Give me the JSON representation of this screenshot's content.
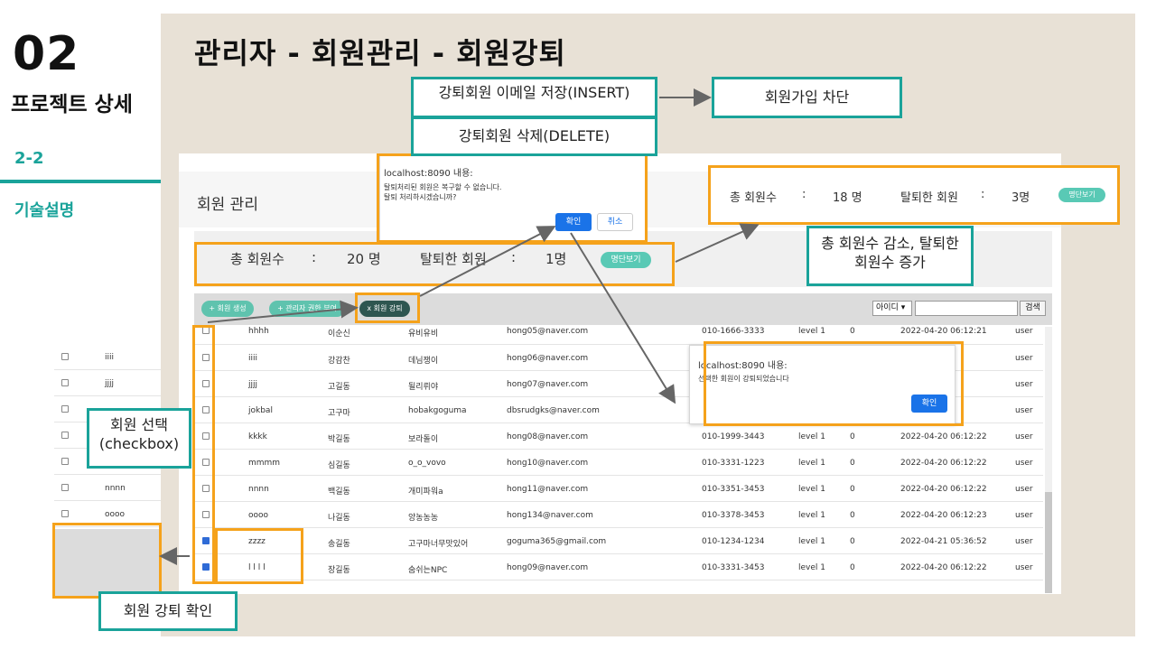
{
  "section": {
    "number": "02",
    "title": "프로젝트 상세",
    "sub": "2-2",
    "topic": "기술설명"
  },
  "page_title": "관리자 - 회원관리 - 회원강퇴",
  "annotations": {
    "save_email": "강퇴회원 이메일 저장(INSERT)",
    "block_signup": "회원가입 차단",
    "delete_member": "강퇴회원 삭제(DELETE)",
    "member_count_change": "총 회원수 감소, 탈퇴한 회원수 증가",
    "select_member": "회원 선택(checkbox)",
    "kick_confirm": "회원 강퇴 확인"
  },
  "admin": {
    "title": "회원 관리",
    "stats_before": {
      "total_label": "총 회원수",
      "sep": ":",
      "total_value": "20 명",
      "withdrawn_label": "탈퇴한 회원",
      "withdrawn_value": "1명",
      "blacklist_button": "명단보기"
    },
    "stats_after": {
      "total_label": "총 회원수",
      "sep": ":",
      "total_value": "18 명",
      "withdrawn_label": "탈퇴한 회원",
      "withdrawn_value": "3명",
      "blacklist_button": "명단보기"
    },
    "toolbar": {
      "create": "+ 회원 생성",
      "grant_admin": "+ 관리자 권한 부여",
      "kick": "x 회원 강퇴"
    },
    "search": {
      "select_value": "아이디 ▾",
      "button": "검색"
    }
  },
  "confirm_dialog": {
    "header": "localhost:8090 내용:",
    "message_line1": "탈퇴처리된 회원은 복구할 수 없습니다.",
    "message_line2": "탈퇴 처리하시겠습니까?",
    "ok": "확인",
    "cancel": "취소"
  },
  "done_dialog": {
    "header": "localhost:8090 내용:",
    "message": "선택한 회원이 강퇴되었습니다",
    "ok": "확인"
  },
  "table": {
    "partial_row": {
      "id": "hhhh",
      "name": "이순신",
      "nick": "유비유비",
      "email": "hong05@naver.com",
      "phone": "010-1666-3333",
      "level": "level 1",
      "point": "0",
      "date": "2022-04-20 06:12:21",
      "role": "user"
    },
    "rows": [
      {
        "checked": false,
        "id": "iiii",
        "name": "강감찬",
        "nick": "데님쟁이",
        "email": "hong06@naver.com",
        "phone": "",
        "level": "",
        "point": "",
        "date": ":21",
        "role": "user"
      },
      {
        "checked": false,
        "id": "jjjj",
        "name": "고길동",
        "nick": "될리뤼야",
        "email": "hong07@naver.com",
        "phone": "",
        "level": "",
        "point": "",
        "date": ":22",
        "role": "user"
      },
      {
        "checked": false,
        "id": "jokbal",
        "name": "고구마",
        "nick": "hobakgoguma",
        "email": "dbsrudgks@naver.com",
        "phone": "",
        "level": "",
        "point": "",
        "date": ":22",
        "role": "user"
      },
      {
        "checked": false,
        "id": "kkkk",
        "name": "박길동",
        "nick": "보라돌이",
        "email": "hong08@naver.com",
        "phone": "010-1999-3443",
        "level": "level 1",
        "point": "0",
        "date": "2022-04-20 06:12:22",
        "role": "user"
      },
      {
        "checked": false,
        "id": "mmmm",
        "name": "심길동",
        "nick": "o_o_vovo",
        "email": "hong10@naver.com",
        "phone": "010-3331-1223",
        "level": "level 1",
        "point": "0",
        "date": "2022-04-20 06:12:22",
        "role": "user"
      },
      {
        "checked": false,
        "id": "nnnn",
        "name": "백길동",
        "nick": "개미파워a",
        "email": "hong11@naver.com",
        "phone": "010-3351-3453",
        "level": "level 1",
        "point": "0",
        "date": "2022-04-20 06:12:22",
        "role": "user"
      },
      {
        "checked": false,
        "id": "oooo",
        "name": "나길동",
        "nick": "앙농농농",
        "email": "hong134@naver.com",
        "phone": "010-3378-3453",
        "level": "level 1",
        "point": "0",
        "date": "2022-04-20 06:12:23",
        "role": "user"
      },
      {
        "checked": true,
        "id": "zzzz",
        "name": "송길동",
        "nick": "고구마너무맛있어",
        "email": "goguma365@gmail.com",
        "phone": "010-1234-1234",
        "level": "level 1",
        "point": "0",
        "date": "2022-04-21 05:36:52",
        "role": "user"
      },
      {
        "checked": true,
        "id": "l l l l",
        "name": "장길동",
        "nick": "숨쉬는NPC",
        "email": "hong09@naver.com",
        "phone": "010-3331-3453",
        "level": "level 1",
        "point": "0",
        "date": "2022-04-20 06:12:22",
        "role": "user"
      }
    ],
    "after_rows": [
      {
        "id": "iiii"
      },
      {
        "id": "jjjj"
      },
      {
        "id": ""
      },
      {
        "id": ""
      },
      {
        "id": ""
      },
      {
        "id": "nnnn"
      },
      {
        "id": "oooo"
      }
    ]
  },
  "colors": {
    "teal": "#1aa39a",
    "orange": "#f5a21b",
    "panel": "#e8e1d6",
    "mint": "#59c9b5"
  }
}
